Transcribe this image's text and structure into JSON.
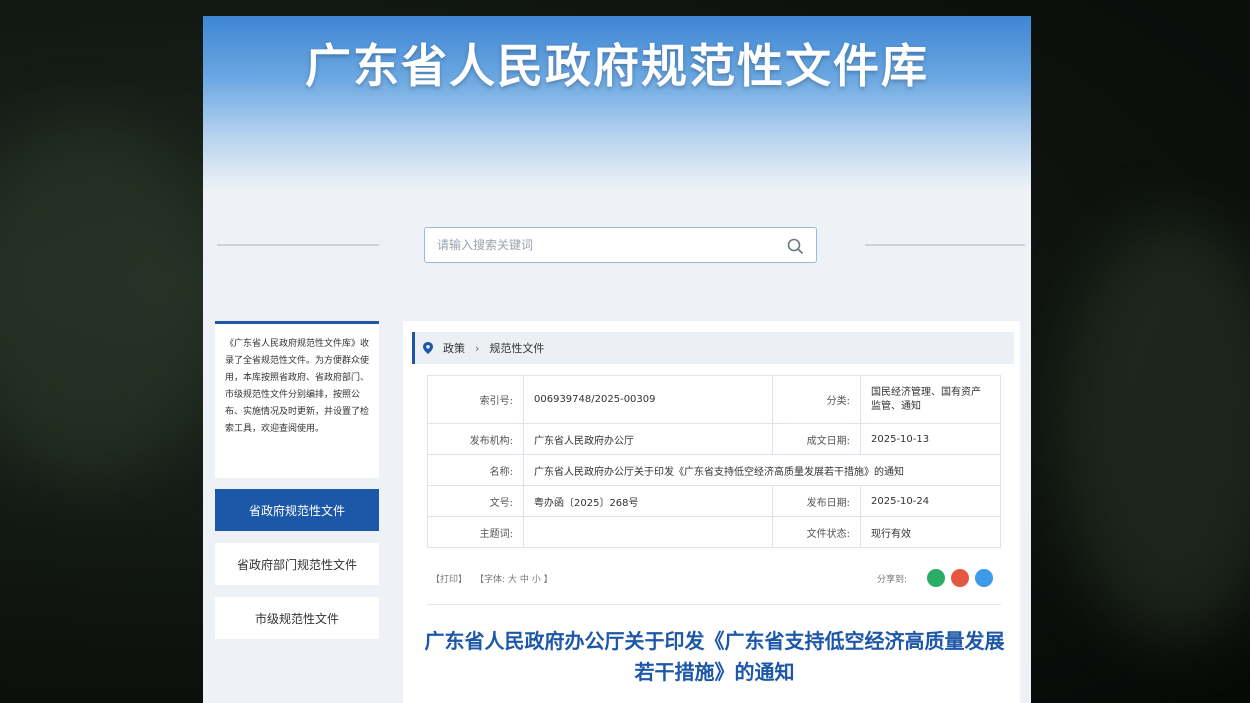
{
  "banner": {
    "title": "广东省人民政府规范性文件库"
  },
  "search": {
    "placeholder": "请输入搜索关键词"
  },
  "sidebar": {
    "intro": "《广东省人民政府规范性文件库》收录了全省规范性文件。为方便群众使用，本库按照省政府、省政府部门、市级规范性文件分别编排，按照公布、实施情况及时更新，并设置了检索工具，欢迎查阅使用。",
    "items": [
      {
        "label": "省政府规范性文件",
        "active": true
      },
      {
        "label": "省政府部门规范性文件",
        "active": false
      },
      {
        "label": "市级规范性文件",
        "active": false
      }
    ]
  },
  "breadcrumb": {
    "items": [
      "政策",
      "规范性文件"
    ]
  },
  "meta": {
    "index_label": "索引号:",
    "index_value": "006939748/2025-00309",
    "category_label": "分类:",
    "category_value": "国民经济管理、国有资产监管、通知",
    "issuer_label": "发布机构:",
    "issuer_value": "广东省人民政府办公厅",
    "created_label": "成文日期:",
    "created_value": "2025-10-13",
    "name_label": "名称:",
    "name_value": "广东省人民政府办公厅关于印发《广东省支持低空经济高质量发展若干措施》的通知",
    "docno_label": "文号:",
    "docno_value": "粤办函〔2025〕268号",
    "published_label": "发布日期:",
    "published_value": "2025-10-24",
    "keywords_label": "主题词:",
    "keywords_value": "",
    "status_label": "文件状态:",
    "status_value": "现行有效"
  },
  "toolbar": {
    "print": "【打印】",
    "font_prefix": "【字体:",
    "font_large": "大",
    "font_medium": "中",
    "font_small": "小",
    "font_suffix": "】",
    "share": "分享到:"
  },
  "document": {
    "title": "广东省人民政府办公厅关于印发《广东省支持低空经济高质量发展若干措施》的通知"
  },
  "colors": {
    "accent": "#1d57a8",
    "wechat": "#2aae67",
    "weibo": "#e6573f",
    "qq": "#3d9be9"
  }
}
